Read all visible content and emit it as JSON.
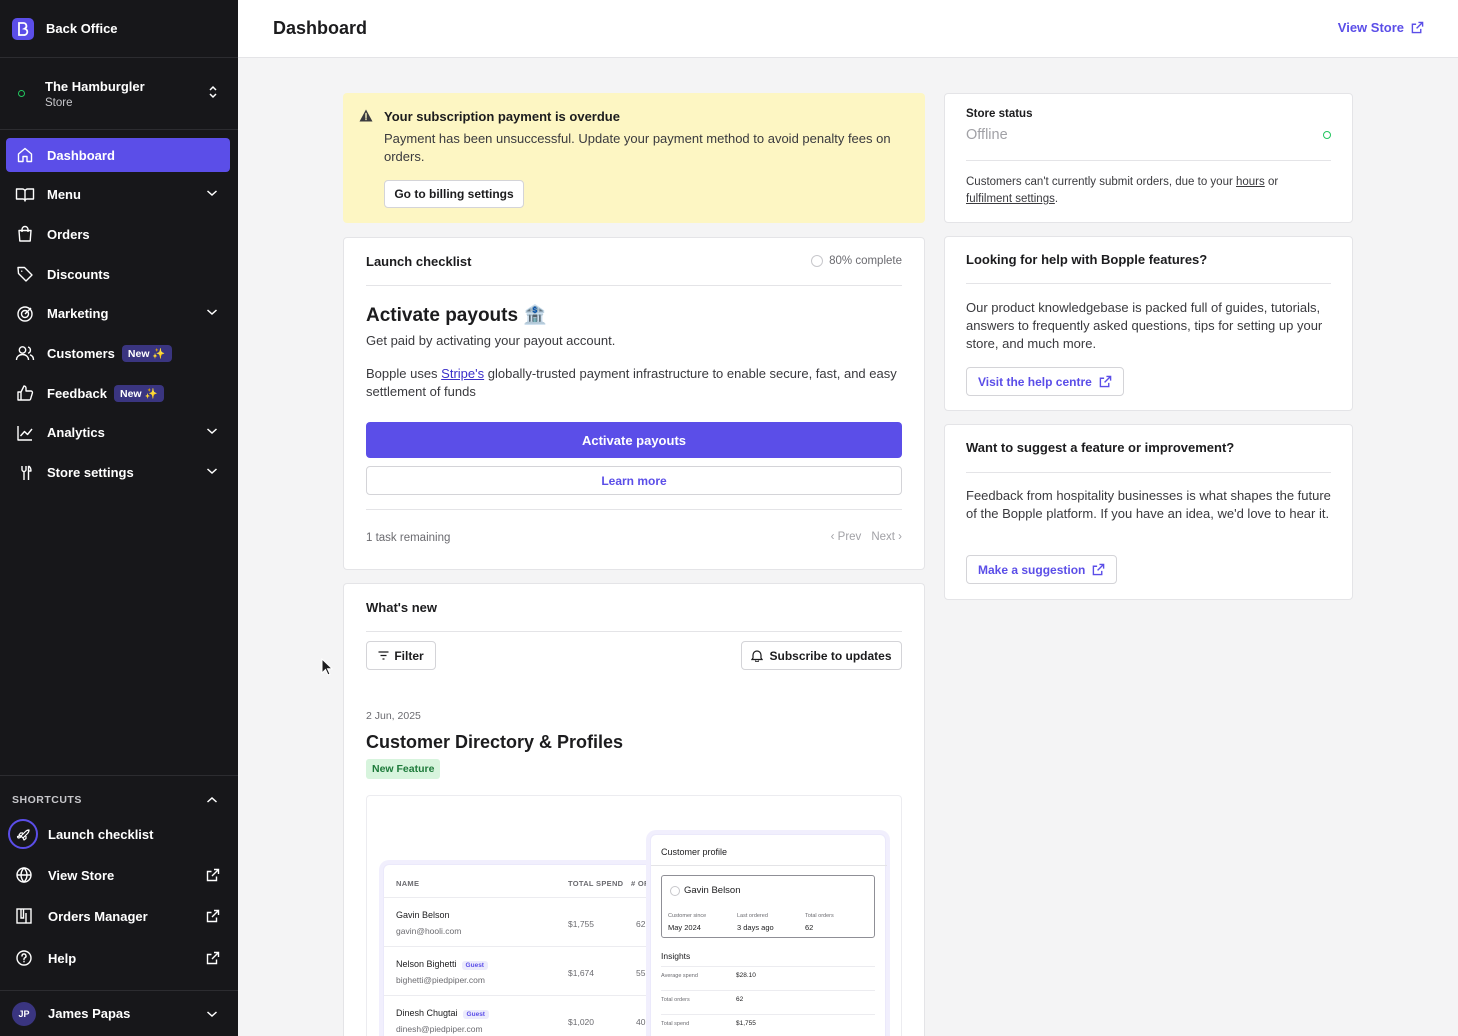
{
  "app": {
    "title": "Back Office"
  },
  "store": {
    "name": "The Hamburgler",
    "subtitle": "Store"
  },
  "nav": {
    "items": [
      {
        "label": "Dashboard",
        "icon": "home-icon"
      },
      {
        "label": "Menu",
        "icon": "book-icon"
      },
      {
        "label": "Orders",
        "icon": "bag-icon"
      },
      {
        "label": "Discounts",
        "icon": "tag-icon"
      },
      {
        "label": "Marketing",
        "icon": "target-icon"
      },
      {
        "label": "Customers",
        "icon": "users-icon",
        "badge": "New ✨"
      },
      {
        "label": "Feedback",
        "icon": "thumbs-up-icon",
        "badge": "New ✨"
      },
      {
        "label": "Analytics",
        "icon": "chart-line-icon"
      },
      {
        "label": "Store settings",
        "icon": "wrench-icon"
      }
    ]
  },
  "shortcuts": {
    "heading": "SHORTCUTS",
    "items": [
      {
        "label": "Launch checklist",
        "icon": "rocket-icon"
      },
      {
        "label": "View Store",
        "icon": "globe-icon"
      },
      {
        "label": "Orders Manager",
        "icon": "orders-manager-icon"
      },
      {
        "label": "Help",
        "icon": "help-icon"
      }
    ]
  },
  "user": {
    "initials": "JP",
    "name": "James Papas"
  },
  "header": {
    "title": "Dashboard",
    "view_store": "View Store"
  },
  "alert": {
    "title": "Your subscription payment is overdue",
    "body": "Payment has been unsuccessful. Update your payment method to avoid penalty fees on orders.",
    "button": "Go to billing settings"
  },
  "checklist": {
    "heading": "Launch checklist",
    "progress": "80% complete",
    "progress_value": 0.8,
    "title": "Activate payouts 🏦",
    "subtitle": "Get paid by activating your payout account.",
    "body_before": "Bopple uses ",
    "body_link": "Stripe's",
    "body_after": " globally-trusted payment infrastructure to enable secure, fast, and easy settlement of funds",
    "primary_button": "Activate payouts",
    "secondary_button": "Learn more",
    "remaining": "1 task remaining",
    "prev": "Prev",
    "next": "Next"
  },
  "whats_new": {
    "heading": "What's new",
    "filter": "Filter",
    "subscribe": "Subscribe to updates",
    "date": "2 Jun, 2025",
    "title": "Customer Directory & Profiles",
    "tag": "New Feature",
    "preview": {
      "columns": [
        "NAME",
        "TOTAL SPEND",
        "# ORD"
      ],
      "rows": [
        {
          "name": "Gavin Belson",
          "email": "gavin@hooli.com",
          "spend": "$1,755",
          "orders": "62",
          "guest": ""
        },
        {
          "name": "Nelson Bighetti",
          "email": "bighetti@piedpiper.com",
          "spend": "$1,674",
          "orders": "55",
          "guest": "Guest"
        },
        {
          "name": "Dinesh Chugtai",
          "email": "dinesh@piedpiper.com",
          "spend": "$1,020",
          "orders": "40",
          "guest": "Guest"
        }
      ],
      "profile": {
        "title": "Customer profile",
        "name": "Gavin Belson",
        "since_label": "Customer since",
        "since_value": "May 2024",
        "last_label": "Last ordered",
        "last_value": "3 days ago",
        "total_label": "Total orders",
        "total_value": "62",
        "insights": "Insights",
        "rows": [
          {
            "label": "Average spend",
            "value": "$28.10"
          },
          {
            "label": "Total orders",
            "value": "62"
          },
          {
            "label": "Total spend",
            "value": "$1,755"
          }
        ]
      }
    }
  },
  "store_status": {
    "heading": "Store status",
    "value": "Offline",
    "text_before": "Customers can't currently submit orders, due to your ",
    "link_hours": "hours",
    "text_mid": " or",
    "link_fulfilment": "fulfilment settings",
    "text_after": "."
  },
  "help": {
    "heading": "Looking for help with Bopple features?",
    "body": "Our product knowledgebase is packed full of guides, tutorials, answers to frequently asked questions, tips for setting up your store, and much more.",
    "button": "Visit the help centre"
  },
  "suggest": {
    "heading": "Want to suggest a feature or improvement?",
    "body": "Feedback from hospitality businesses is what shapes the future of the Bopple platform. If you have an idea, we'd love to hear it.",
    "button": "Make a suggestion"
  },
  "colors": {
    "accent": "#5b4ee8",
    "sidebar": "#17171a",
    "alert_bg": "#fdf6c3",
    "success": "#22c55e"
  }
}
